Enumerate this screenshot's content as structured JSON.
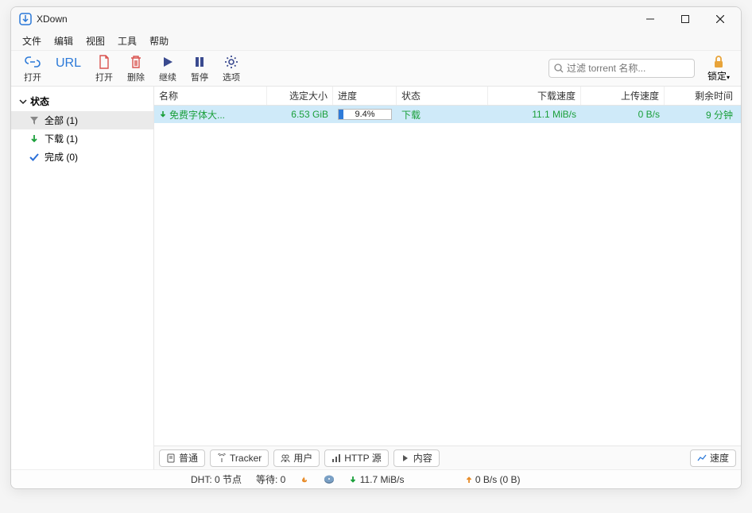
{
  "app": {
    "title": "XDown"
  },
  "menubar": {
    "file": "文件",
    "edit": "编辑",
    "view": "视图",
    "tools": "工具",
    "help": "帮助"
  },
  "toolbar": {
    "open": "打开",
    "url": "URL",
    "open2": "打开",
    "delete": "删除",
    "resume": "继续",
    "pause": "暂停",
    "options": "选项",
    "lock": "锁定"
  },
  "search": {
    "placeholder": "过滤 torrent 名称..."
  },
  "sidebar": {
    "header": "状态",
    "items": [
      {
        "label": "全部 (1)"
      },
      {
        "label": "下载 (1)"
      },
      {
        "label": "完成 (0)"
      }
    ]
  },
  "table": {
    "cols": {
      "name": "名称",
      "size": "选定大小",
      "progress": "进度",
      "status": "状态",
      "dl": "下载速度",
      "ul": "上传速度",
      "eta": "剩余时间"
    },
    "row0": {
      "name": "免费字体大...",
      "size": "6.53 GiB",
      "progress_pct": 9.4,
      "progress_txt": "9.4%",
      "status": "下载",
      "dl": "11.1 MiB/s",
      "ul": "0 B/s",
      "eta": "9 分钟"
    }
  },
  "tabs": {
    "general": "普通",
    "tracker": "Tracker",
    "users": "用户",
    "http": "HTTP 源",
    "content": "内容",
    "speed": "速度"
  },
  "status": {
    "dht": "DHT: 0 节点",
    "waiting": "等待: 0",
    "dl": "11.7 MiB/s",
    "ul": "0 B/s (0 B)"
  }
}
